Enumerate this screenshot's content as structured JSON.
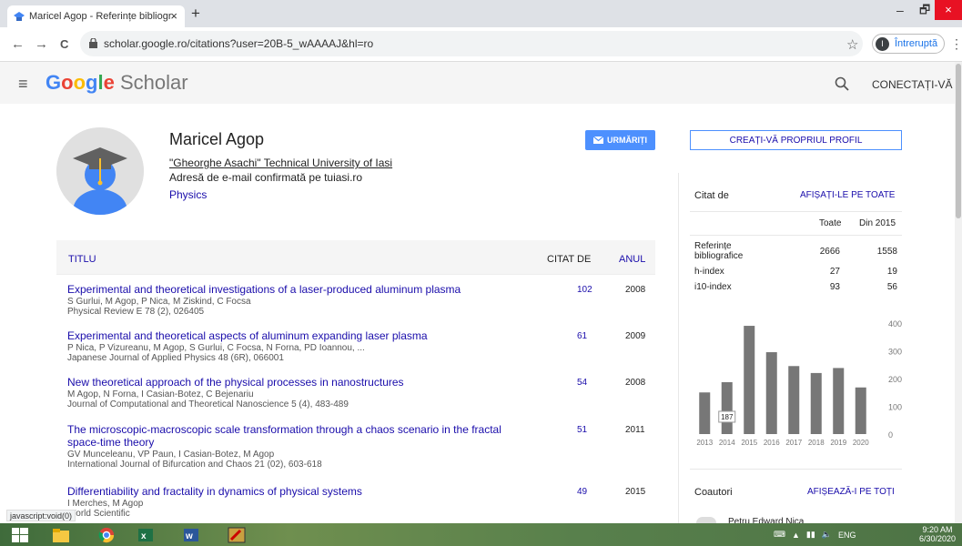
{
  "browser": {
    "tab_title": "Maricel Agop - Referințe bibliogr",
    "tab_close": "×",
    "new_tab": "+",
    "url": "scholar.google.ro/citations?user=20B-5_wAAAAJ&hl=ro",
    "back": "←",
    "forward": "→",
    "reload": "C",
    "star": "☆",
    "profile_initial": "I",
    "profile_status": "Întreruptă",
    "menu": "⋮",
    "win_min": "–",
    "win_max": "🗗",
    "win_close": "×"
  },
  "header": {
    "menu_icon": "≡",
    "logo_google": [
      "G",
      "o",
      "o",
      "g",
      "l",
      "e"
    ],
    "logo_colors": [
      "#4285f4",
      "#ea4335",
      "#fbbc05",
      "#4285f4",
      "#34a853",
      "#ea4335"
    ],
    "logo_scholar": "Scholar",
    "login": "CONECTAȚI-VĂ"
  },
  "profile": {
    "name": "Maricel Agop",
    "affiliation": "\"Gheorghe Asachi\" Technical University of Iasi",
    "email": "Adresă de e-mail confirmată pe tuiasi.ro",
    "interest": "Physics",
    "follow": "URMĂRIȚI"
  },
  "table": {
    "col_title": "TITLU",
    "col_cited": "CITAT DE",
    "col_year": "ANUL",
    "rows": [
      {
        "title": "Experimental and theoretical investigations of a laser-produced aluminum plasma",
        "authors": "S Gurlui, M Agop, P Nica, M Ziskind, C Focsa",
        "journal": "Physical Review E 78 (2), 026405",
        "cited": "102",
        "year": "2008"
      },
      {
        "title": "Experimental and theoretical aspects of aluminum expanding laser plasma",
        "authors": "P Nica, P Vizureanu, M Agop, S Gurlui, C Focsa, N Forna, PD Ioannou, ...",
        "journal": "Japanese Journal of Applied Physics 48 (6R), 066001",
        "cited": "61",
        "year": "2009"
      },
      {
        "title": "New theoretical approach of the physical processes in nanostructures",
        "authors": "M Agop, N Forna, I Casian-Botez, C Bejenariu",
        "journal": "Journal of Computational and Theoretical Nanoscience 5 (4), 483-489",
        "cited": "54",
        "year": "2008"
      },
      {
        "title": "The microscopic-macroscopic scale transformation through a chaos scenario in the fractal space-time theory",
        "authors": "GV Munceleanu, VP Paun, I Casian-Botez, M Agop",
        "journal": "International Journal of Bifurcation and Chaos 21 (02), 603-618",
        "cited": "51",
        "year": "2011"
      },
      {
        "title": "Differentiability and fractality in dynamics of physical systems",
        "authors": "I Merches, M Agop",
        "journal": "World Scientific",
        "cited": "49",
        "year": "2015"
      }
    ]
  },
  "sidebar": {
    "create_profile": "CREAȚI-VĂ PROPRIUL PROFIL",
    "cited_by": "Citat de",
    "show_all": "AFIȘAȚI-LE PE TOATE",
    "col_all": "Toate",
    "col_since": "Din 2015",
    "stats": [
      {
        "label": "Referințe bibliografice",
        "all": "2666",
        "since": "1558"
      },
      {
        "label": "h-index",
        "all": "27",
        "since": "19"
      },
      {
        "label": "i10-index",
        "all": "93",
        "since": "56"
      }
    ],
    "coauthors": "Coautori",
    "coauthors_all": "AFIȘEAZĂ-I PE TOȚI",
    "coauthor_partial": "Petru Edward Nica"
  },
  "chart_data": {
    "type": "bar",
    "categories": [
      "2013",
      "2014",
      "2015",
      "2016",
      "2017",
      "2018",
      "2019",
      "2020"
    ],
    "values": [
      150,
      187,
      390,
      295,
      245,
      220,
      238,
      168
    ],
    "ylim": [
      0,
      400
    ],
    "yticks": [
      0,
      100,
      200,
      300,
      400
    ],
    "tooltip_value": "187",
    "tooltip_index": 1,
    "bar_color": "#777777"
  },
  "status_bar": "javascript:void(0)",
  "taskbar": {
    "tray_lang": "ENG",
    "time": "9:20 AM",
    "date": "6/30/2020"
  }
}
